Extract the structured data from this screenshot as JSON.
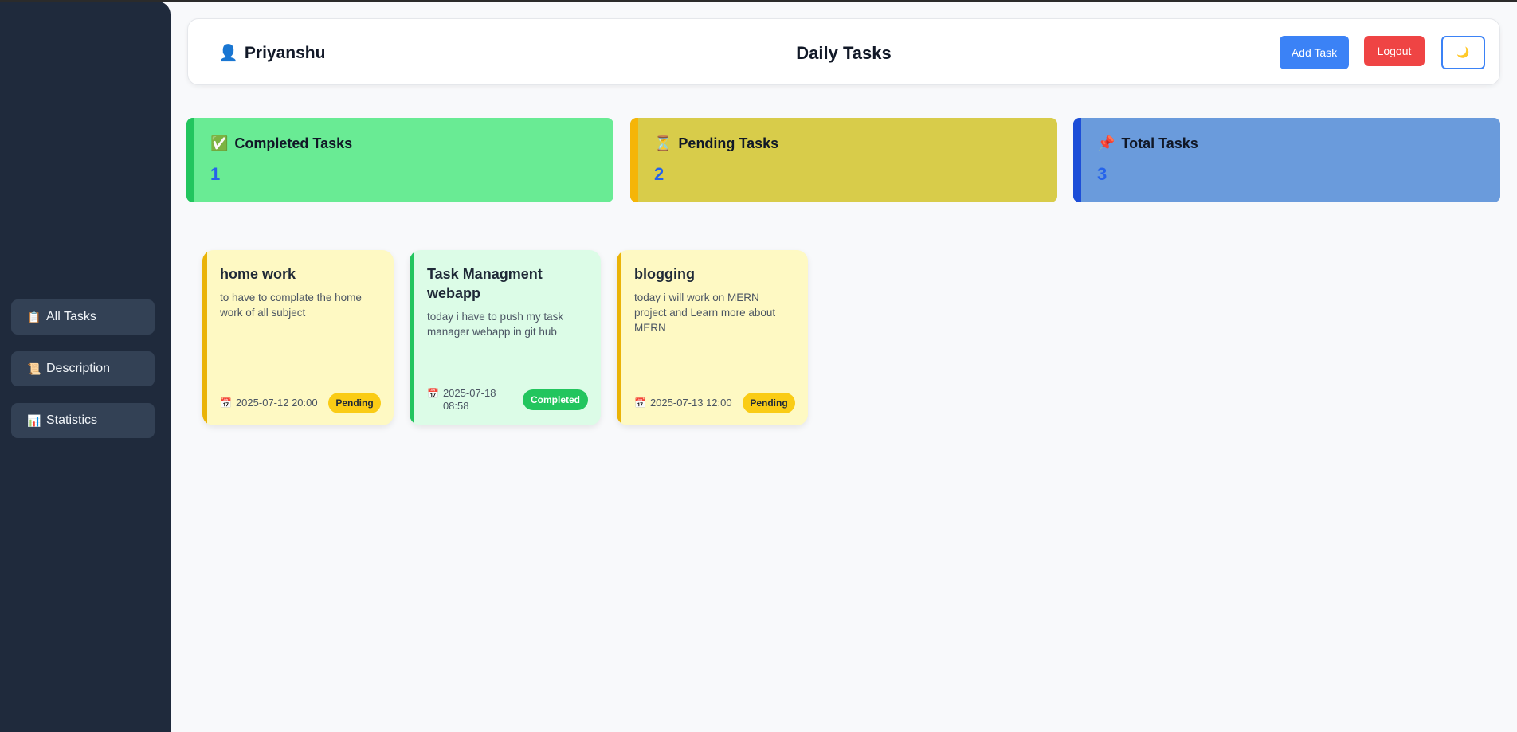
{
  "sidebar": {
    "items": [
      {
        "icon": "📋",
        "label": "All Tasks"
      },
      {
        "icon": "📜",
        "label": "Description"
      },
      {
        "icon": "📊",
        "label": "Statistics"
      }
    ]
  },
  "header": {
    "user_icon": "👤",
    "user_name": "Priyanshu",
    "title": "Daily Tasks",
    "add_task_label": "Add Task",
    "logout_label": "Logout",
    "theme_icon": "🌙"
  },
  "stats": [
    {
      "icon": "✅",
      "label": "Completed Tasks",
      "count": "1",
      "color": "#69eb94",
      "accent": "#22c55e"
    },
    {
      "icon": "⏳",
      "label": "Pending Tasks",
      "count": "2",
      "color": "#d8cc4a",
      "accent": "#f5b507"
    },
    {
      "icon": "📌",
      "label": "Total Tasks",
      "count": "3",
      "color": "#6a9bdc",
      "accent": "#1d4ed8"
    }
  ],
  "tasks": [
    {
      "title": "home work",
      "description": "to have to complate the home work of all subject",
      "date_icon": "📅",
      "date": "2025-07-12 20:00",
      "status": "Pending",
      "bg": "#fef9c3",
      "accent": "#eab308"
    },
    {
      "title": "Task Managment webapp",
      "description": "today i have to push my task manager webapp in git hub",
      "date_icon": "📅",
      "date": "2025-07-18 08:58",
      "status": "Completed",
      "bg": "#dcfce7",
      "accent": "#22c55e"
    },
    {
      "title": "blogging",
      "description": "today i will work on MERN project and Learn more about MERN",
      "date_icon": "📅",
      "date": "2025-07-13 12:00",
      "status": "Pending",
      "bg": "#fef9c3",
      "accent": "#eab308"
    }
  ]
}
